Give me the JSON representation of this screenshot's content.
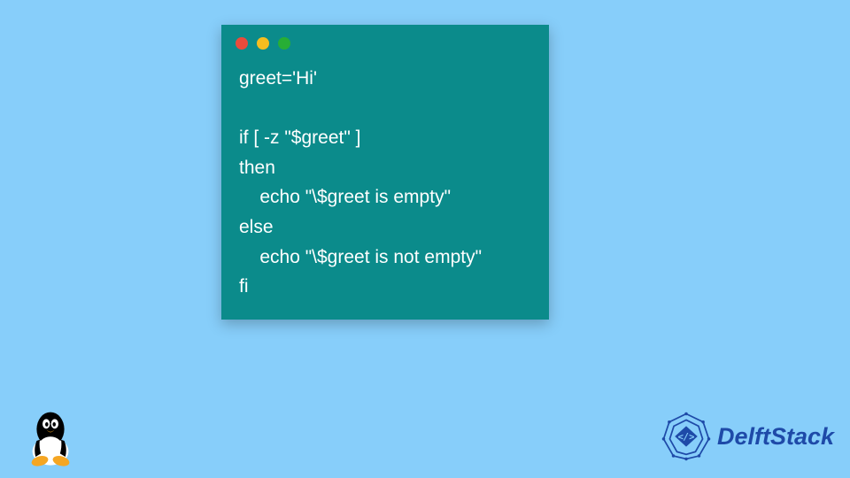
{
  "window": {
    "controls": [
      "red",
      "yellow",
      "green"
    ]
  },
  "code": {
    "line1": "greet='Hi'",
    "line2": "",
    "line3": "if [ -z \"$greet\" ]",
    "line4": "then",
    "line5": "    echo \"\\$greet is empty\"",
    "line6": "else",
    "line7": "    echo \"\\$greet is not empty\"",
    "line8": "fi"
  },
  "brand": {
    "name": "DelftStack"
  }
}
